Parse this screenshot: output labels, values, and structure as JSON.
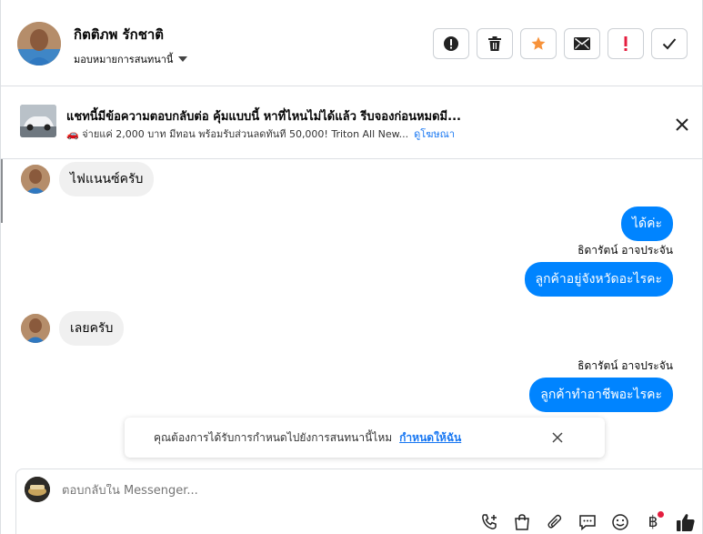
{
  "header": {
    "contact_name": "กิตติภพ รักชาติ",
    "assign_label": "มอบหมายการสนทนานี้",
    "actions": [
      {
        "name": "report-icon",
        "color": "#222222"
      },
      {
        "name": "trash-icon",
        "color": "#222222"
      },
      {
        "name": "star-icon",
        "color": "#f7923a"
      },
      {
        "name": "mail-icon",
        "color": "#222222"
      },
      {
        "name": "exclamation-icon",
        "color": "#e41e3f"
      },
      {
        "name": "check-icon",
        "color": "#222222"
      }
    ]
  },
  "ad": {
    "title": "แชทนี้มีข้อความตอบกลับต่อ คุ้มแบบนี้ หาที่ไหนไม่ได้แล้ว รีบจองก่อนหมดมี...",
    "subtitle": "🚗 จ่ายแค่ 2,000 บาท มีทอน พร้อมรับส่วนลดทันที 50,000! Triton All New...",
    "link_label": "ดูโฆษณา"
  },
  "messages": [
    {
      "direction": "in",
      "text": "ไฟแนนซ์ครับ"
    },
    {
      "direction": "out",
      "text": "ได้ค่ะ"
    },
    {
      "direction": "out",
      "sender": "ธิดารัตน์ อาจประจัน",
      "text": "ลูกค้าอยู่จังหวัดอะไรคะ"
    },
    {
      "direction": "in",
      "text": "เลยครับ"
    },
    {
      "direction": "out",
      "sender": "ธิดารัตน์ อาจประจัน",
      "text": "ลูกค้าทำอาชีพอะไรคะ"
    }
  ],
  "toast": {
    "text": "คุณต้องการได้รับการกำหนดไปยังการสนทนานี้ไหม",
    "link_label": "กำหนดให้ฉัน"
  },
  "composer": {
    "placeholder": "ตอบกลับใน Messenger...",
    "currency_symbol": "฿"
  },
  "colors": {
    "accent": "#0084ff",
    "link": "#1877f2",
    "notification_dot": "#e41e3f"
  }
}
